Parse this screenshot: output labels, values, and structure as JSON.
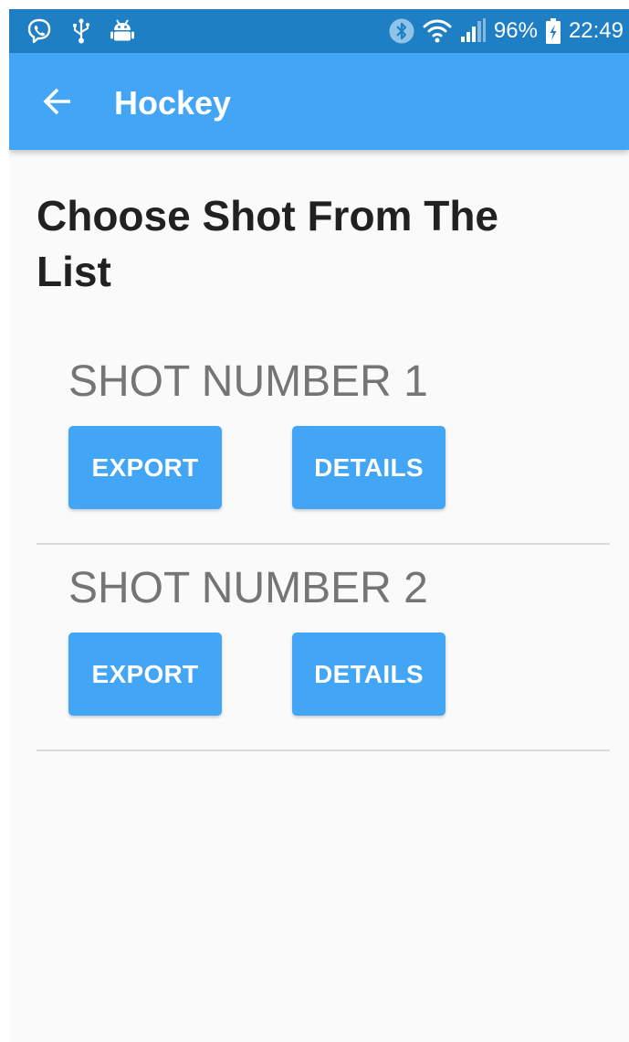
{
  "status_bar": {
    "left_icons": [
      "viber-icon",
      "usb-icon",
      "android-debug-icon"
    ],
    "right_icons": [
      "bluetooth-icon",
      "wifi-icon",
      "cell-signal-icon",
      "battery-charging-icon"
    ],
    "battery": "96%",
    "time": "22:49",
    "background_color": "#1f7fc4"
  },
  "app_bar": {
    "back_icon": "arrow-left-icon",
    "title": "Hockey",
    "background_color": "#42a5f5"
  },
  "page": {
    "heading": "Choose Shot From The List"
  },
  "shots": [
    {
      "label": "SHOT NUMBER 1",
      "export_label": "EXPORT",
      "details_label": "DETAILS"
    },
    {
      "label": "SHOT NUMBER 2",
      "export_label": "EXPORT",
      "details_label": "DETAILS"
    }
  ],
  "colors": {
    "accent": "#42a5f5",
    "background": "#fafafa",
    "heading_text": "#212121",
    "shot_label_text": "#757575",
    "divider": "#dcdcdc"
  }
}
